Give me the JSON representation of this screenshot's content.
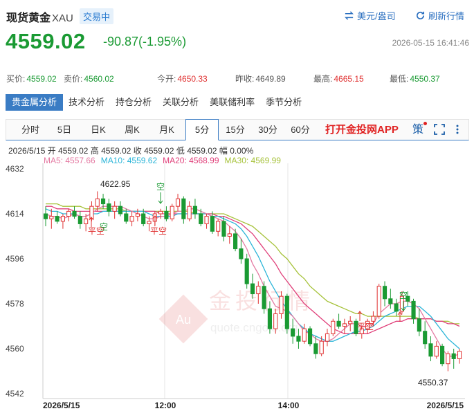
{
  "header": {
    "title": "现货黄金",
    "symbol": "XAU",
    "status_badge": "交易中",
    "currency_toggle": "美元/盎司",
    "refresh": "刷新行情",
    "price": "4559.02",
    "change": "-90.87(-1.95%)",
    "datetime": "2026-05-15 16:41:46"
  },
  "quotes": [
    {
      "label": "买价:",
      "value": "4559.02",
      "trend": "dn"
    },
    {
      "label": "卖价:",
      "value": "4560.02",
      "trend": "dn"
    },
    {
      "label": "今开:",
      "value": "4650.33",
      "trend": "up"
    },
    {
      "label": "昨收:",
      "value": "4649.89",
      "trend": "nt"
    },
    {
      "label": "最高:",
      "value": "4665.15",
      "trend": "up"
    },
    {
      "label": "最低:",
      "value": "4550.37",
      "trend": "dn"
    }
  ],
  "analysis_tabs": [
    "贵金属分析",
    "技术分析",
    "持仓分析",
    "关联分析",
    "美联储利率",
    "季节分析"
  ],
  "period_tabs": [
    "分时",
    "5日",
    "日K",
    "周K",
    "月K",
    "5分",
    "15分",
    "30分",
    "60分"
  ],
  "active_period": "5分",
  "app_link": "打开金投网APP",
  "strategy_icon_text": "策",
  "ohlc_line": "2026/5/15  开 4559.02  高 4559.02  收 4559.02  低 4559.02  幅 0.00%",
  "ma_legend": [
    {
      "text": "MA5: 4557.66",
      "color": "#e47aa2"
    },
    {
      "text": "MA10: 4559.62",
      "color": "#2bb5d8"
    },
    {
      "text": "MA20: 4568.99",
      "color": "#e0407a"
    },
    {
      "text": "MA30: 4569.99",
      "color": "#a6c23a"
    }
  ],
  "watermark": {
    "cn": "金投行情",
    "en": "quote.cngold.org",
    "logo": "Au"
  },
  "colors": {
    "up": "#e03030",
    "down": "#1a9a33",
    "accent": "#3a7cc4"
  },
  "chart_data": {
    "type": "candlestick",
    "y_ticks": [
      4632,
      4614,
      4596,
      4578,
      4560,
      4542
    ],
    "ylim": [
      4540,
      4635
    ],
    "x_ticks": [
      "2026/5/15",
      "12:00",
      "14:00",
      "2026/5/15"
    ],
    "annotations": {
      "high_label": "4622.95",
      "low_label": "4550.37",
      "signals": [
        "空",
        "平空",
        "空",
        "平空",
        "空",
        "平空",
        "空",
        "平空"
      ]
    },
    "candles": [
      [
        4614,
        4617,
        4609,
        4612
      ],
      [
        4612,
        4616,
        4608,
        4613
      ],
      [
        4613,
        4615,
        4610,
        4611
      ],
      [
        4611,
        4614,
        4608,
        4613
      ],
      [
        4613,
        4616,
        4611,
        4615
      ],
      [
        4615,
        4617,
        4612,
        4613
      ],
      [
        4613,
        4615,
        4608,
        4610
      ],
      [
        4610,
        4614,
        4607,
        4612
      ],
      [
        4612,
        4619,
        4611,
        4617
      ],
      [
        4617,
        4623,
        4615,
        4620
      ],
      [
        4620,
        4622,
        4616,
        4618
      ],
      [
        4618,
        4620,
        4613,
        4615
      ],
      [
        4615,
        4619,
        4612,
        4617
      ],
      [
        4617,
        4619,
        4613,
        4614
      ],
      [
        4614,
        4616,
        4610,
        4611
      ],
      [
        4611,
        4615,
        4609,
        4613
      ],
      [
        4613,
        4616,
        4611,
        4614
      ],
      [
        4614,
        4616,
        4609,
        4610
      ],
      [
        4610,
        4613,
        4607,
        4611
      ],
      [
        4611,
        4615,
        4609,
        4614
      ],
      [
        4614,
        4616,
        4612,
        4615
      ],
      [
        4615,
        4617,
        4611,
        4612
      ],
      [
        4612,
        4618,
        4611,
        4617
      ],
      [
        4617,
        4622,
        4615,
        4620
      ],
      [
        4620,
        4621,
        4610,
        4612
      ],
      [
        4612,
        4619,
        4611,
        4617
      ],
      [
        4617,
        4620,
        4612,
        4614
      ],
      [
        4614,
        4616,
        4609,
        4610
      ],
      [
        4610,
        4614,
        4608,
        4613
      ],
      [
        4613,
        4615,
        4606,
        4607
      ],
      [
        4607,
        4612,
        4605,
        4611
      ],
      [
        4611,
        4613,
        4603,
        4605
      ],
      [
        4605,
        4609,
        4602,
        4606
      ],
      [
        4606,
        4608,
        4599,
        4600
      ],
      [
        4600,
        4604,
        4594,
        4596
      ],
      [
        4596,
        4598,
        4584,
        4586
      ],
      [
        4586,
        4590,
        4580,
        4582
      ],
      [
        4582,
        4587,
        4578,
        4585
      ],
      [
        4585,
        4587,
        4574,
        4576
      ],
      [
        4576,
        4579,
        4566,
        4568
      ],
      [
        4568,
        4576,
        4566,
        4574
      ],
      [
        4574,
        4583,
        4572,
        4581
      ],
      [
        4581,
        4582,
        4566,
        4568
      ],
      [
        4568,
        4572,
        4562,
        4565
      ],
      [
        4565,
        4568,
        4560,
        4563
      ],
      [
        4563,
        4570,
        4562,
        4568
      ],
      [
        4568,
        4569,
        4561,
        4562
      ],
      [
        4562,
        4565,
        4556,
        4558
      ],
      [
        4558,
        4565,
        4557,
        4563
      ],
      [
        4563,
        4568,
        4561,
        4566
      ],
      [
        4566,
        4572,
        4565,
        4571
      ],
      [
        4571,
        4574,
        4568,
        4569
      ],
      [
        4569,
        4572,
        4566,
        4570
      ],
      [
        4570,
        4573,
        4567,
        4571
      ],
      [
        4571,
        4572,
        4565,
        4566
      ],
      [
        4566,
        4569,
        4564,
        4568
      ],
      [
        4568,
        4572,
        4566,
        4571
      ],
      [
        4571,
        4575,
        4569,
        4573
      ],
      [
        4573,
        4586,
        4572,
        4585
      ],
      [
        4585,
        4587,
        4577,
        4580
      ],
      [
        4580,
        4584,
        4576,
        4578
      ],
      [
        4578,
        4580,
        4573,
        4575
      ],
      [
        4575,
        4583,
        4574,
        4581
      ],
      [
        4581,
        4583,
        4577,
        4579
      ],
      [
        4579,
        4580,
        4570,
        4572
      ],
      [
        4572,
        4576,
        4565,
        4567
      ],
      [
        4567,
        4571,
        4560,
        4562
      ],
      [
        4562,
        4565,
        4555,
        4557
      ],
      [
        4557,
        4563,
        4556,
        4561
      ],
      [
        4561,
        4562,
        4553,
        4554
      ],
      [
        4554,
        4559,
        4551,
        4558
      ],
      [
        4558,
        4560,
        4552,
        4556
      ],
      [
        4556,
        4560,
        4554,
        4559
      ]
    ],
    "ma5": [
      4614,
      4613,
      4613,
      4612,
      4613,
      4614,
      4613,
      4613,
      4614,
      4616,
      4617,
      4617,
      4617,
      4617,
      4616,
      4615,
      4614,
      4613,
      4612,
      4612,
      4613,
      4613,
      4614,
      4615,
      4615,
      4616,
      4616,
      4615,
      4614,
      4613,
      4612,
      4611,
      4609,
      4607,
      4604,
      4600,
      4594,
      4590,
      4585,
      4581,
      4577,
      4576,
      4575,
      4573,
      4570,
      4567,
      4566,
      4564,
      4563,
      4563,
      4564,
      4566,
      4568,
      4570,
      4570,
      4569,
      4569,
      4570,
      4574,
      4576,
      4578,
      4578,
      4579,
      4579,
      4578,
      4576,
      4572,
      4568,
      4564,
      4560,
      4557,
      4557,
      4558
    ],
    "ma10": [
      4616,
      4615,
      4615,
      4614,
      4614,
      4614,
      4613,
      4613,
      4614,
      4614,
      4615,
      4615,
      4615,
      4615,
      4615,
      4615,
      4615,
      4615,
      4614,
      4613,
      4613,
      4613,
      4613,
      4614,
      4614,
      4614,
      4614,
      4614,
      4614,
      4613,
      4613,
      4612,
      4611,
      4610,
      4608,
      4605,
      4601,
      4597,
      4592,
      4587,
      4583,
      4579,
      4576,
      4573,
      4570,
      4568,
      4566,
      4565,
      4564,
      4563,
      4563,
      4564,
      4565,
      4566,
      4567,
      4567,
      4568,
      4569,
      4571,
      4573,
      4574,
      4575,
      4576,
      4577,
      4577,
      4577,
      4575,
      4573,
      4570,
      4567,
      4564,
      4562,
      4560
    ],
    "ma20": [
      4617,
      4617,
      4616,
      4616,
      4616,
      4615,
      4615,
      4615,
      4615,
      4615,
      4615,
      4615,
      4615,
      4615,
      4615,
      4615,
      4615,
      4615,
      4615,
      4615,
      4614,
      4614,
      4614,
      4614,
      4614,
      4614,
      4614,
      4614,
      4614,
      4614,
      4613,
      4613,
      4612,
      4611,
      4610,
      4608,
      4606,
      4603,
      4600,
      4597,
      4594,
      4590,
      4587,
      4584,
      4581,
      4578,
      4576,
      4574,
      4572,
      4570,
      4568,
      4567,
      4566,
      4566,
      4566,
      4566,
      4566,
      4567,
      4568,
      4569,
      4570,
      4571,
      4571,
      4572,
      4572,
      4572,
      4572,
      4572,
      4571,
      4571,
      4570,
      4570,
      4569
    ],
    "ma30": [
      4618,
      4618,
      4618,
      4617,
      4617,
      4617,
      4617,
      4616,
      4616,
      4616,
      4616,
      4616,
      4616,
      4616,
      4615,
      4615,
      4615,
      4615,
      4615,
      4615,
      4615,
      4615,
      4615,
      4615,
      4615,
      4615,
      4614,
      4614,
      4614,
      4614,
      4614,
      4614,
      4613,
      4612,
      4611,
      4610,
      4609,
      4607,
      4605,
      4603,
      4601,
      4598,
      4596,
      4593,
      4590,
      4588,
      4585,
      4583,
      4581,
      4579,
      4578,
      4577,
      4576,
      4575,
      4574,
      4574,
      4573,
      4573,
      4573,
      4573,
      4573,
      4573,
      4573,
      4573,
      4573,
      4572,
      4572,
      4572,
      4571,
      4571,
      4571,
      4570,
      4570
    ]
  }
}
